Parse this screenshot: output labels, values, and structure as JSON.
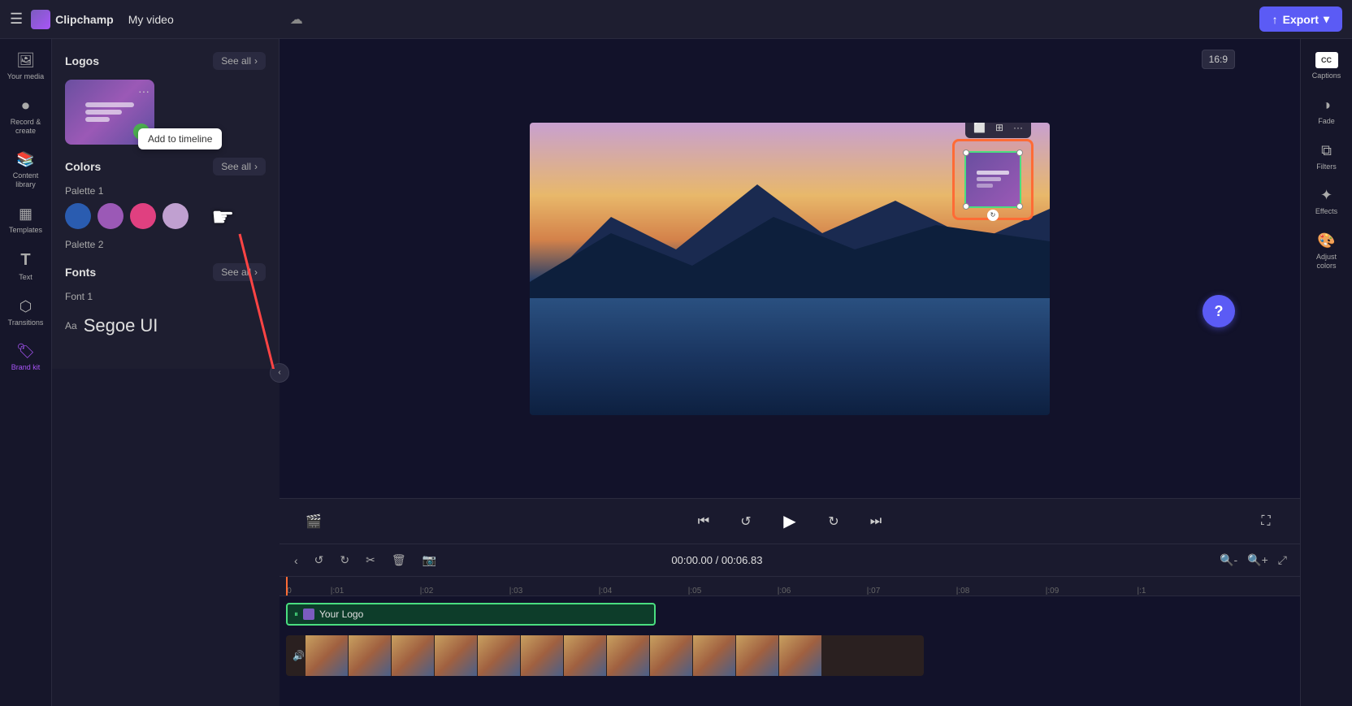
{
  "app": {
    "name": "Clipchamp",
    "title": "My video",
    "export_label": "Export"
  },
  "sidebar": {
    "items": [
      {
        "id": "your-media",
        "label": "Your media",
        "icon": "🖼"
      },
      {
        "id": "record-create",
        "label": "Record &\ncreate",
        "icon": "⏺"
      },
      {
        "id": "content-library",
        "label": "Content library",
        "icon": "📚"
      },
      {
        "id": "templates",
        "label": "Templates",
        "icon": "▦"
      },
      {
        "id": "text",
        "label": "Text",
        "icon": "T"
      },
      {
        "id": "transitions",
        "label": "Transitions",
        "icon": "⬡"
      },
      {
        "id": "brand-kit",
        "label": "Brand kit",
        "icon": "🏷"
      }
    ]
  },
  "brand_panel": {
    "logos_title": "Logos",
    "see_all": "See all",
    "logo_name": "Your Logo",
    "add_to_timeline": "Add to timeline",
    "colors_title": "Colors",
    "palette1_label": "Palette 1",
    "palette1_colors": [
      "#2a5cb0",
      "#9b59b6",
      "#e04080",
      "#c0a0d0"
    ],
    "palette2_label": "Palette 2",
    "fonts_title": "Fonts",
    "fonts_see_all": "See all",
    "font1_label": "Font 1",
    "font1_aa": "Aa",
    "font1_name": "Segoe UI"
  },
  "video": {
    "time_current": "00:00.00",
    "time_total": "00:06.83",
    "time_display": "00:00.00 / 00:06.83",
    "aspect_ratio": "16:9"
  },
  "timeline": {
    "ruler_marks": [
      "0",
      "|:01",
      "|:02",
      "|:03",
      "|:04",
      "|:05",
      "|:06",
      "|:07",
      "|:08",
      "|:09",
      "|:1"
    ],
    "logo_track_label": "Your Logo",
    "zoom_in": "+",
    "zoom_out": "-"
  },
  "right_sidebar": {
    "items": [
      {
        "id": "captions",
        "label": "Captions",
        "type": "cc"
      },
      {
        "id": "fade",
        "label": "Fade",
        "icon": "◑"
      },
      {
        "id": "filters",
        "label": "Filters",
        "icon": "🎛"
      },
      {
        "id": "effects",
        "label": "Effects",
        "icon": "✨"
      },
      {
        "id": "adjust-colors",
        "label": "Adjust colors",
        "icon": "🎨"
      }
    ]
  },
  "colors": {
    "accent": "#5b5bf5",
    "green": "#4ade80",
    "orange": "#ff6b35",
    "purple": "#9b59b6"
  }
}
